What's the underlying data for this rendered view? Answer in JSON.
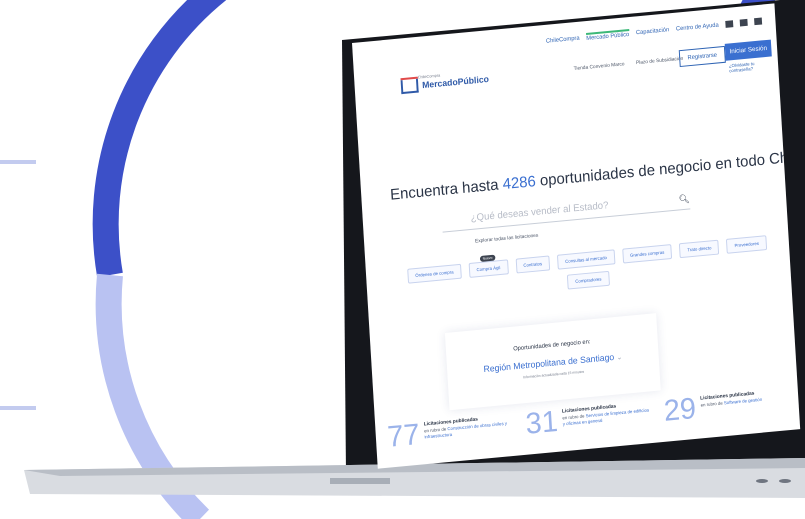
{
  "top_nav": {
    "links": [
      "ChileCompra",
      "Mercado Público",
      "Capacitación",
      "Centro de Ayuda"
    ]
  },
  "header": {
    "logo_top": "ChileCompra",
    "logo_text": "MercadoPúblico",
    "links": [
      "Tienda Convenio Marco",
      "Plazo de Subsidiación"
    ],
    "register_label": "Registrarse",
    "login_label": "Iniciar Sesión",
    "forgot_label": "¿Olvidaste tu contraseña?"
  },
  "hero": {
    "headline_before": "Encuentra hasta ",
    "headline_number": "4286",
    "headline_after": " oportunidades de negocio en todo Chile",
    "search_placeholder": "¿Qué deseas vender al Estado?",
    "explore_label": "Explorar todas las licitaciones"
  },
  "chips": [
    {
      "label": "Órdenes de compra",
      "badge": ""
    },
    {
      "label": "Compra Ágil",
      "badge": "Nuevo"
    },
    {
      "label": "Contratos",
      "badge": ""
    },
    {
      "label": "Consultas al mercado",
      "badge": ""
    },
    {
      "label": "Grandes compras",
      "badge": ""
    },
    {
      "label": "Trato directo",
      "badge": ""
    },
    {
      "label": "Proveedores",
      "badge": ""
    },
    {
      "label": "Compradores",
      "badge": ""
    }
  ],
  "opportunities": {
    "title": "Oportunidades de negocio en:",
    "region": "Región Metropolitana de Santiago",
    "note": "Información actualizada cada 15 minutos"
  },
  "stats": [
    {
      "number": "77",
      "title": "Licitaciones publicadas",
      "prefix": "en rubro de ",
      "rubro": "Construcción de obras civiles y infraestructura"
    },
    {
      "number": "31",
      "title": "Licitaciones publicadas",
      "prefix": "en rubro de ",
      "rubro": "Servicios de limpieza de edificios y oficinas en general"
    },
    {
      "number": "29",
      "title": "Licitaciones publicadas",
      "prefix": "en rubro de ",
      "rubro": "Software de gestión"
    }
  ],
  "colors": {
    "brand_blue": "#3a6fd0",
    "arc_blue": "#3c50c8",
    "arc_light": "#b9c2f2",
    "active_green": "#3cb878"
  }
}
